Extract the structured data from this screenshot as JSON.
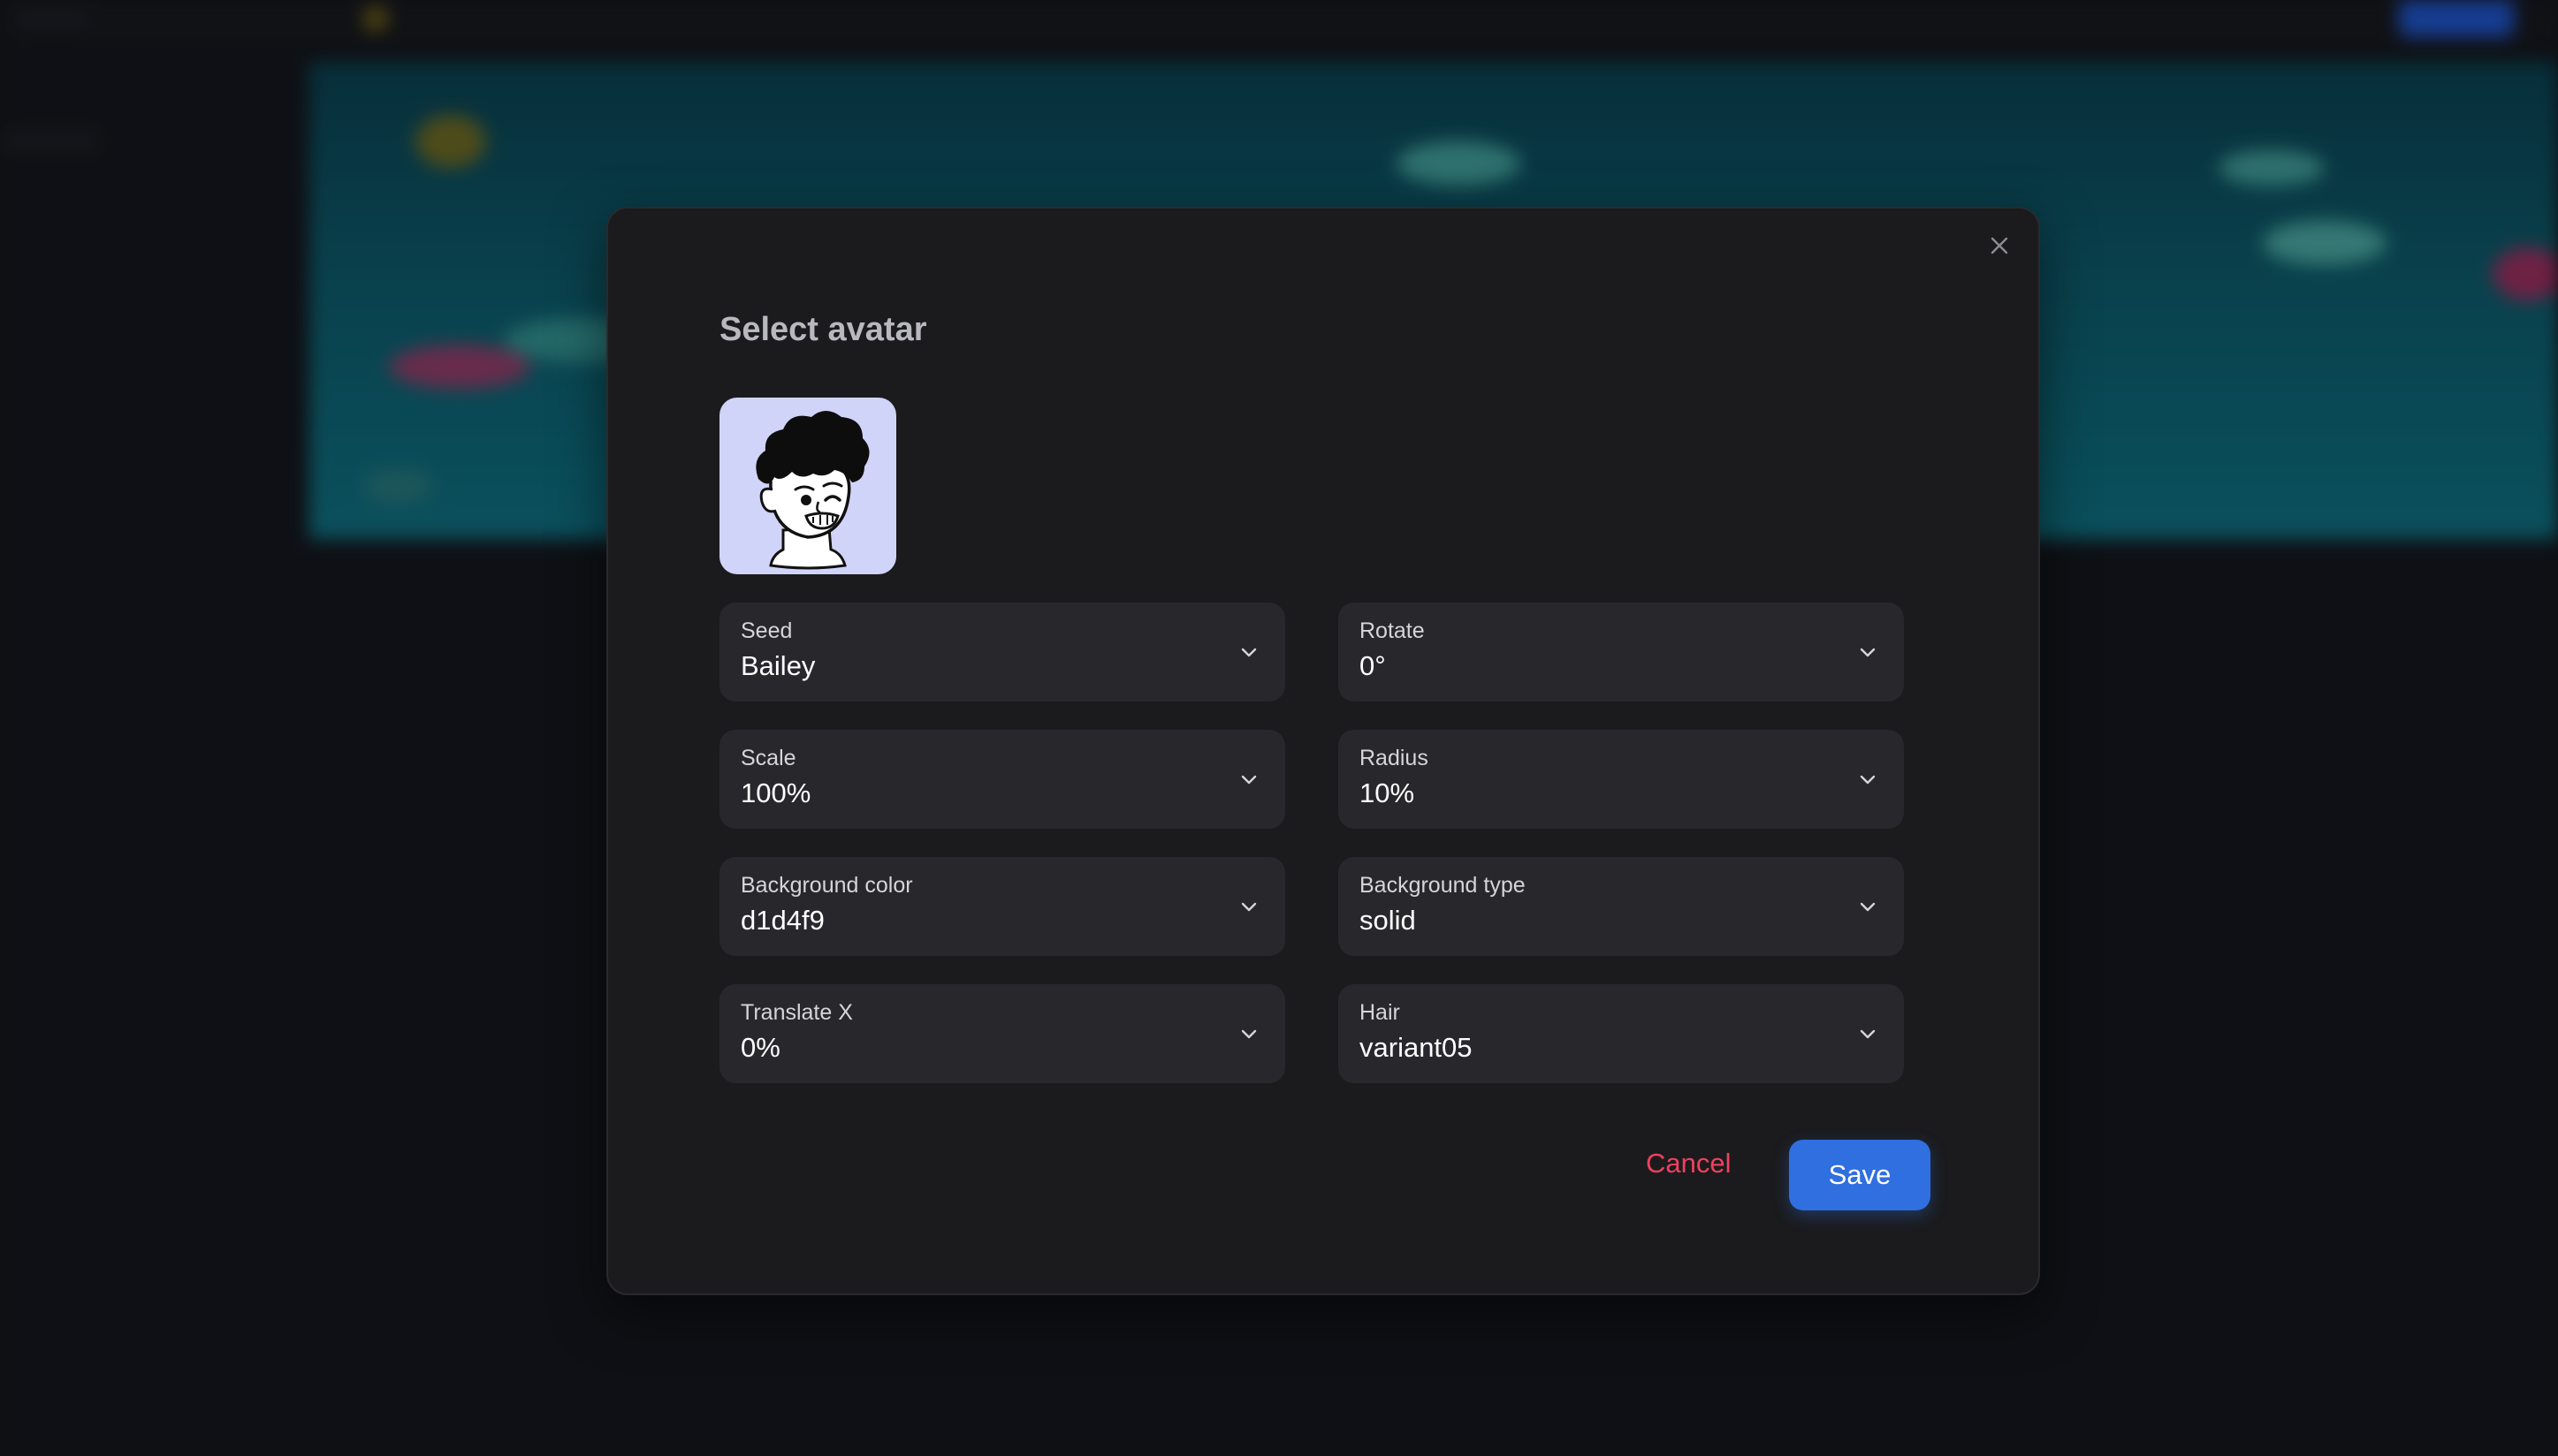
{
  "modal": {
    "title": "Select avatar",
    "avatar": {
      "background_color": "#d1d4f9",
      "icon": "cartoon-face-winking"
    },
    "fields": [
      {
        "id": "seed",
        "label": "Seed",
        "value": "Bailey"
      },
      {
        "id": "rotate",
        "label": "Rotate",
        "value": "0°"
      },
      {
        "id": "scale",
        "label": "Scale",
        "value": "100%"
      },
      {
        "id": "radius",
        "label": "Radius",
        "value": "10%"
      },
      {
        "id": "background-color",
        "label": "Background color",
        "value": "d1d4f9"
      },
      {
        "id": "background-type",
        "label": "Background type",
        "value": "solid"
      },
      {
        "id": "translate-x",
        "label": "Translate X",
        "value": "0%"
      },
      {
        "id": "hair",
        "label": "Hair",
        "value": "variant05"
      }
    ],
    "cancel_label": "Cancel",
    "save_label": "Save"
  },
  "colors": {
    "accent": "#2f6fe0",
    "danger": "#f0405f",
    "modal_bg": "#1b1b1d",
    "field_bg": "#28282c"
  },
  "icons": {
    "close": "close-icon",
    "dropdown": "chevron-down-icon"
  }
}
